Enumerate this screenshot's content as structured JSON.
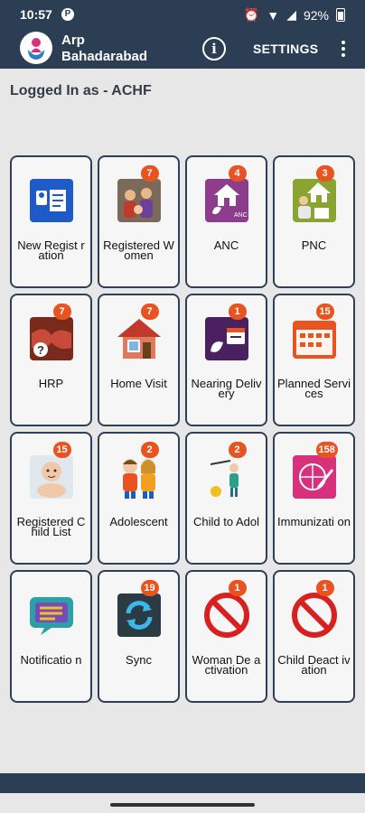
{
  "status_bar": {
    "time": "10:57",
    "battery": "92%"
  },
  "app_bar": {
    "title": "Arp Bahadarabad",
    "info_label": "i",
    "settings_label": "SETTINGS"
  },
  "logged_in": {
    "text": "Logged In as -  ACHF"
  },
  "tiles": [
    {
      "label": "New Regist ration",
      "badge": "",
      "icon": "registration-icon"
    },
    {
      "label": "Registered Women",
      "badge": "7",
      "icon": "women-icon"
    },
    {
      "label": "ANC",
      "badge": "4",
      "icon": "anc-icon"
    },
    {
      "label": "PNC",
      "badge": "3",
      "icon": "pnc-icon"
    },
    {
      "label": "HRP",
      "badge": "7",
      "icon": "hrp-icon"
    },
    {
      "label": "Home Visit",
      "badge": "7",
      "icon": "house-icon"
    },
    {
      "label": "Nearing Delivery",
      "badge": "1",
      "icon": "delivery-icon"
    },
    {
      "label": "Planned Services",
      "badge": "15",
      "icon": "calendar-icon"
    },
    {
      "label": "Registered Child List",
      "badge": "15",
      "icon": "baby-icon"
    },
    {
      "label": "Adolescent",
      "badge": "2",
      "icon": "adolescent-icon"
    },
    {
      "label": "Child to Adol",
      "badge": "2",
      "icon": "child-to-adol-icon"
    },
    {
      "label": "Immunizati on",
      "badge": "158",
      "icon": "immunization-icon"
    },
    {
      "label": "Notificatio n",
      "badge": "",
      "icon": "chat-icon"
    },
    {
      "label": "Sync",
      "badge": "19",
      "icon": "sync-icon"
    },
    {
      "label": "Woman De activation",
      "badge": "1",
      "icon": "prohibited-icon"
    },
    {
      "label": "Child Deact ivation",
      "badge": "1",
      "icon": "prohibited-icon"
    }
  ]
}
